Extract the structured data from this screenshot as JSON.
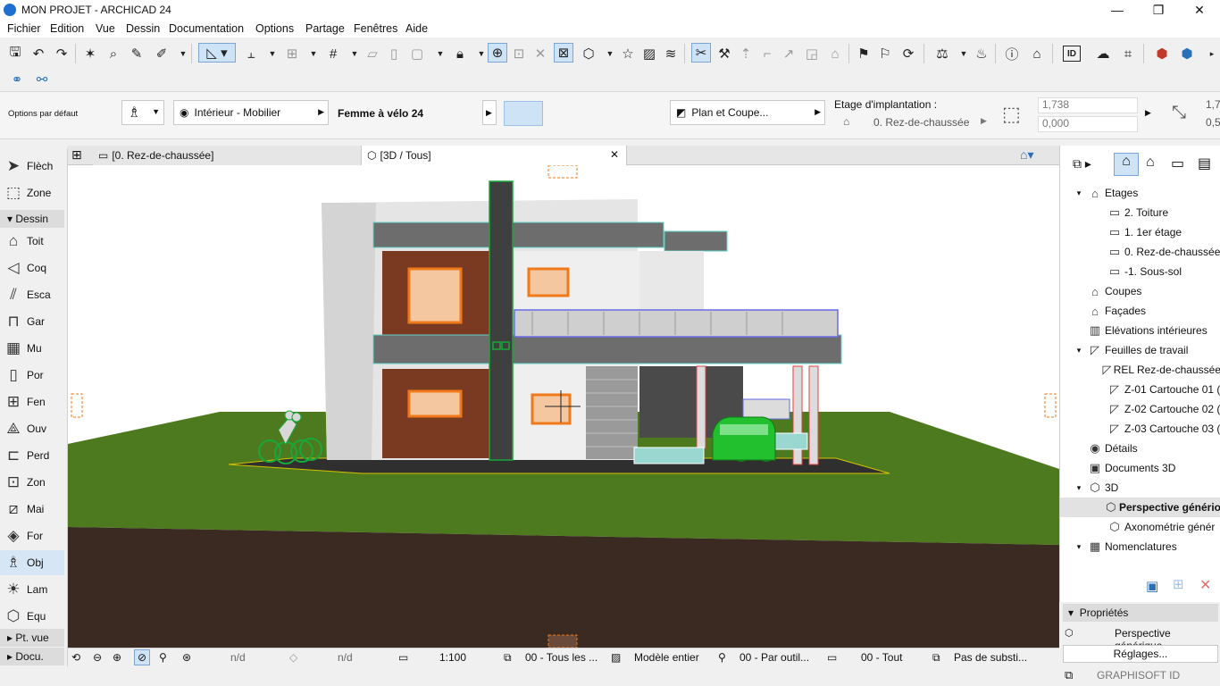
{
  "window": {
    "title": "MON PROJET  - ARCHICAD 24",
    "buttons": [
      "—",
      "❐",
      "✕"
    ]
  },
  "menu": [
    "Fichier",
    "Edition",
    "Vue",
    "Dessin",
    "Documentation",
    "Options",
    "Partage",
    "Fenêtres",
    "Aide"
  ],
  "infobox": {
    "default_options": "Options par défaut",
    "layer": "Intérieur - Mobilier",
    "object_name": "Femme à vélo 24",
    "floorplan_section": "Plan et Coupe...",
    "home_story_label": "Etage d'implantation :",
    "home_story_value": "0. Rez-de-chaussée",
    "height_value": "1,738",
    "offset_value": "0,000",
    "right_value_1": "1,7",
    "right_value_2": "0,5"
  },
  "toolbox": {
    "arrow": "Flèch",
    "marquee": "Zone",
    "group_design": "Dessin",
    "tools": [
      "Toit",
      "Coq",
      "Esca",
      "Gar",
      "Mu",
      "Por",
      "Fen",
      "Ouv",
      "Perd",
      "Zon",
      "Mai",
      "For",
      "Obj",
      "Lam",
      "Equ"
    ],
    "group_viewpoint": "Pt. vue",
    "group_docu": "Docu."
  },
  "tabs": {
    "plan": "[0. Rez-de-chaussée]",
    "view3d": "[3D / Tous]",
    "close": "✕"
  },
  "statusbar": {
    "nd1": "n/d",
    "nd2": "n/d",
    "scale": "1:100",
    "layers": "00 - Tous les ...",
    "model": "Modèle entier",
    "pen": "00 - Par outil...",
    "renov": "00 - Tout",
    "subst": "Pas de substi..."
  },
  "navigator": {
    "items": [
      {
        "label": "Etages",
        "level": 1,
        "tog": "▾",
        "icon": "⌂"
      },
      {
        "label": "2. Toiture",
        "level": 2,
        "tog": "",
        "icon": "▭"
      },
      {
        "label": "1. 1er étage",
        "level": 2,
        "tog": "",
        "icon": "▭"
      },
      {
        "label": "0. Rez-de-chaussée",
        "level": 2,
        "tog": "",
        "icon": "▭"
      },
      {
        "label": "-1. Sous-sol",
        "level": 2,
        "tog": "",
        "icon": "▭"
      },
      {
        "label": "Coupes",
        "level": 1,
        "tog": "",
        "icon": "⌂"
      },
      {
        "label": "Façades",
        "level": 1,
        "tog": "",
        "icon": "⌂"
      },
      {
        "label": "Elévations intérieures",
        "level": 1,
        "tog": "",
        "icon": "▥"
      },
      {
        "label": "Feuilles de travail",
        "level": 1,
        "tog": "▾",
        "icon": "◸"
      },
      {
        "label": "REL Rez-de-chaussée",
        "level": 2,
        "tog": "",
        "icon": "◸"
      },
      {
        "label": "Z-01 Cartouche 01 (",
        "level": 2,
        "tog": "",
        "icon": "◸"
      },
      {
        "label": "Z-02 Cartouche 02 (",
        "level": 2,
        "tog": "",
        "icon": "◸"
      },
      {
        "label": "Z-03 Cartouche 03 (",
        "level": 2,
        "tog": "",
        "icon": "◸"
      },
      {
        "label": "Détails",
        "level": 1,
        "tog": "",
        "icon": "◉"
      },
      {
        "label": "Documents 3D",
        "level": 1,
        "tog": "",
        "icon": "▣"
      },
      {
        "label": "3D",
        "level": 1,
        "tog": "▾",
        "icon": "⬡"
      },
      {
        "label": "Perspective génério",
        "level": 2,
        "tog": "",
        "icon": "⬡",
        "selected": true
      },
      {
        "label": "Axonométrie génér",
        "level": 2,
        "tog": "",
        "icon": "⬡"
      },
      {
        "label": "Nomenclatures",
        "level": 1,
        "tog": "▾",
        "icon": "▦"
      }
    ],
    "properties_title": "Propriétés",
    "properties_value": "Perspective générique",
    "settings_button": "Réglages...",
    "brand": "GRAPHISOFT ID"
  },
  "colors": {
    "accent": "#2b6fb6",
    "grass": "#4e7a1f",
    "soil": "#3b2a22",
    "selection_orange": "#f07a1a",
    "selection_green": "#19a73a"
  }
}
